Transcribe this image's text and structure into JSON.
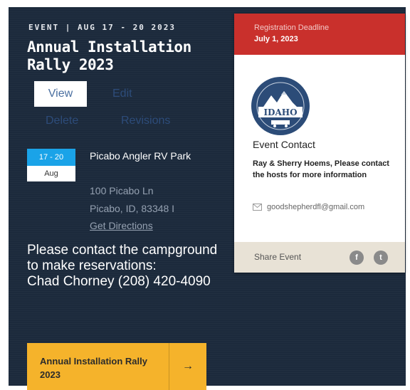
{
  "event": {
    "eyebrow": "EVENT | AUG 17 - 20 2023",
    "title": "Annual Installation Rally 2023"
  },
  "tabs": {
    "view": "View",
    "edit": "Edit",
    "delete": "Delete",
    "revisions": "Revisions"
  },
  "date_badge": {
    "days": "17 - 20",
    "month": "Aug"
  },
  "venue": {
    "name": "Picabo Angler RV Park",
    "address_line1": "100 Picabo Ln",
    "address_line2": "Picabo, ID, 83348 I",
    "directions_label": "Get Directions"
  },
  "note": {
    "line1": "Please contact the campground to make reservations:",
    "line2": "Chad Chorney (208) 420-4090"
  },
  "cta": {
    "label": "Annual Installation Rally 2023",
    "arrow": "→"
  },
  "card": {
    "deadline_label": "Registration Deadline",
    "deadline_date": "July 1, 2023",
    "logo_text": "IDAHO",
    "contact_heading": "Event Contact",
    "contact_text": "Ray & Sherry Hoems, Please contact the hosts for more information",
    "email": "goodshepherdfl@gmail.com",
    "share_label": "Share Event",
    "social_facebook_glyph": "f",
    "social_twitter_glyph": "t"
  },
  "colors": {
    "panel_bg": "#1c2a3c",
    "card_header": "#c9302c",
    "cta_bg": "#f5b32b",
    "badge_blue": "#1aa3e8",
    "share_bar": "#e8e2d6"
  },
  "icons": {
    "email": "envelope-icon",
    "arrow": "arrow-right-icon",
    "facebook": "facebook-icon",
    "twitter": "twitter-icon"
  }
}
